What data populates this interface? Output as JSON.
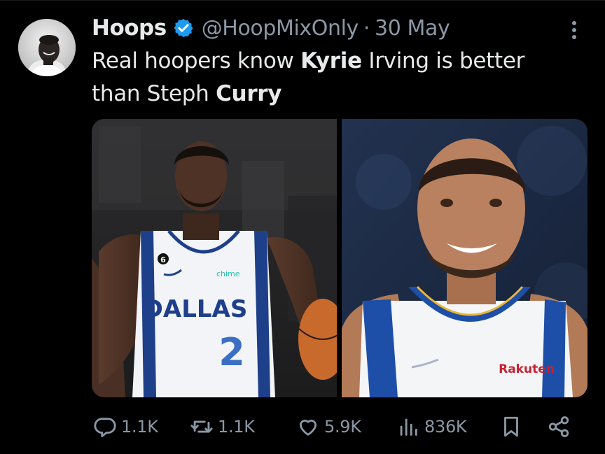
{
  "tweet": {
    "author": {
      "display_name": "Hoops",
      "handle": "@HoopMixOnly",
      "verified": true,
      "avatar_icon": "profile-avatar"
    },
    "separator": "·",
    "timestamp": "30 May",
    "text": {
      "part1": "Real hoopers know ",
      "bold1": "Kyrie",
      "part2": " Irving is better than Steph ",
      "bold2": "Curry"
    },
    "media": {
      "left_photo": {
        "jersey_text": "DALLAS",
        "jersey_number": "2",
        "patch_number": "6",
        "sponsor": "chime"
      },
      "right_photo": {
        "sponsor": "Rakuten"
      }
    },
    "actions": {
      "replies": "1.1K",
      "reposts": "1.1K",
      "likes": "5.9K",
      "views": "836K"
    }
  },
  "colors": {
    "background": "#000000",
    "primary_text": "#e7e9ea",
    "secondary_text": "#8b98a5",
    "verified_blue": "#1d9bf0"
  }
}
